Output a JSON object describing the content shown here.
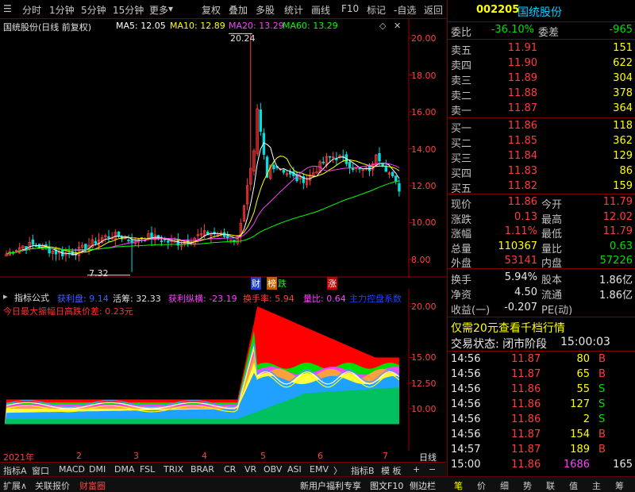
{
  "toolbar": {
    "items": [
      "分时",
      "1分钟",
      "5分钟",
      "15分钟",
      "更多",
      "复权",
      "叠加",
      "多股",
      "统计",
      "画线",
      "F10",
      "标记",
      "-自选",
      "返回"
    ]
  },
  "chart_header": {
    "title": "国统股份(日线 前复权)",
    "ma5": "MA5: 12.05",
    "ma10": "MA10: 12.89",
    "ma20": "MA20: 13.29",
    "ma60": "MA60: 13.29",
    "high_label": "20.24",
    "low_label": "7.32",
    "price_axis": [
      "20.00",
      "18.00",
      "16.00",
      "14.00",
      "12.00",
      "10.00",
      "8.00"
    ],
    "markers": {
      "cai": "财",
      "bang": "榜",
      "die": "跌",
      "zhang": "涨"
    }
  },
  "indicator": {
    "name": "指标公式",
    "items": [
      {
        "text": "获利盘: 9.14",
        "color": "#4060ff"
      },
      {
        "text": "活筹: 32.33",
        "color": "#e0e0e0"
      },
      {
        "text": "获利纵横: -23.19",
        "color": "#ff40ff"
      },
      {
        "text": "换手率: 5.94",
        "color": "#ff4040"
      },
      {
        "text": "量比: 0.64",
        "color": "#ff40ff"
      },
      {
        "text": "主力控盘系数",
        "color": "#2040ff"
      }
    ],
    "subline": "今日最大振幅日高跌价差: 0.23元",
    "axis": [
      "20.00",
      "15.00",
      "12.50",
      "10.00"
    ]
  },
  "time_axis": {
    "year": "2021年",
    "months": [
      "2",
      "3",
      "4",
      "5",
      "6",
      "7"
    ],
    "right": "日线"
  },
  "bottom_tabs": {
    "row1": [
      "指标A",
      "窗口",
      "MACD",
      "DMI",
      "DMA",
      "FSL",
      "TRIX",
      "BRAR",
      "CR",
      "VR",
      "OBV",
      "ASI",
      "EMV",
      "〉",
      "指标B",
      "模 板",
      "+",
      "−"
    ],
    "row2_left": [
      "扩展∧",
      "关联报价",
      "财富圈"
    ],
    "row2_mid": [
      "新用户福利专享",
      "图文F10",
      "侧边栏"
    ],
    "row2_right": [
      "笔",
      "价",
      "细",
      "势",
      "联",
      "值",
      "主",
      "筹"
    ]
  },
  "quote": {
    "code": "002205",
    "name": "国统股份",
    "weibi": {
      "label": "委比",
      "value": "-36.10%",
      "label2": "委差",
      "value2": "-965"
    },
    "asks": [
      {
        "label": "卖五",
        "price": "11.91",
        "vol": "151"
      },
      {
        "label": "卖四",
        "price": "11.90",
        "vol": "622"
      },
      {
        "label": "卖三",
        "price": "11.89",
        "vol": "304"
      },
      {
        "label": "卖二",
        "price": "11.88",
        "vol": "378"
      },
      {
        "label": "卖一",
        "price": "11.87",
        "vol": "364"
      }
    ],
    "bids": [
      {
        "label": "买一",
        "price": "11.86",
        "vol": "118"
      },
      {
        "label": "买二",
        "price": "11.85",
        "vol": "362"
      },
      {
        "label": "买三",
        "price": "11.84",
        "vol": "129"
      },
      {
        "label": "买四",
        "price": "11.83",
        "vol": "86"
      },
      {
        "label": "买五",
        "price": "11.82",
        "vol": "159"
      }
    ],
    "stats": [
      {
        "l1": "现价",
        "v1": "11.86",
        "c1": "red",
        "l2": "今开",
        "v2": "11.79",
        "c2": "red"
      },
      {
        "l1": "涨跌",
        "v1": "0.13",
        "c1": "red",
        "l2": "最高",
        "v2": "12.02",
        "c2": "red"
      },
      {
        "l1": "涨幅",
        "v1": "1.11%",
        "c1": "red",
        "l2": "最低",
        "v2": "11.79",
        "c2": "red"
      },
      {
        "l1": "总量",
        "v1": "110367",
        "c1": "yel",
        "l2": "量比",
        "v2": "0.63",
        "c2": "grn"
      },
      {
        "l1": "外盘",
        "v1": "53141",
        "c1": "red",
        "l2": "内盘",
        "v2": "57226",
        "c2": "grn"
      }
    ],
    "stats2": [
      {
        "l1": "换手",
        "v1": "5.94%",
        "l2": "股本",
        "v2": "1.86亿"
      },
      {
        "l1": "净资",
        "v1": "4.50",
        "l2": "流通",
        "v2": "1.86亿"
      },
      {
        "l1": "收益(一)",
        "v1": "-0.207",
        "l2": "PE(动)",
        "v2": ""
      }
    ],
    "promo": "仅需20元查看千档行情",
    "status_label": "交易状态: 闭市阶段",
    "status_time": "15:00:03",
    "ticks": [
      {
        "t": "14:56",
        "p": "11.87",
        "v": "80",
        "s": "B"
      },
      {
        "t": "14:56",
        "p": "11.87",
        "v": "65",
        "s": "B"
      },
      {
        "t": "14:56",
        "p": "11.86",
        "v": "55",
        "s": "S"
      },
      {
        "t": "14:56",
        "p": "11.86",
        "v": "127",
        "s": "S"
      },
      {
        "t": "14:56",
        "p": "11.86",
        "v": "2",
        "s": "S"
      },
      {
        "t": "14:56",
        "p": "11.87",
        "v": "154",
        "s": "B"
      },
      {
        "t": "14:57",
        "p": "11.87",
        "v": "189",
        "s": "B"
      },
      {
        "t": "15:00",
        "p": "11.86",
        "v": "1686",
        "s": "",
        "n": "165"
      }
    ]
  },
  "colors": {
    "up": "#ff3c3c",
    "down": "#00e0e0",
    "ma5": "#ffffff",
    "ma10": "#ffff00",
    "ma20": "#ff40ff",
    "ma60": "#00ff00"
  }
}
